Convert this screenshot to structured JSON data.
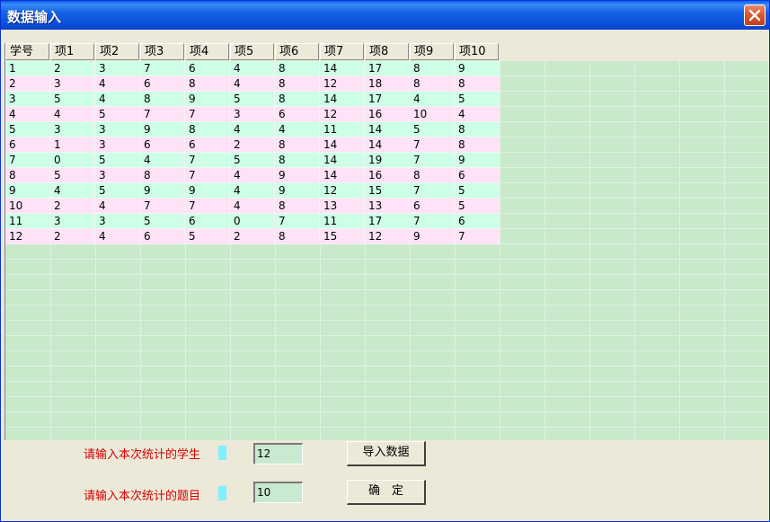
{
  "window": {
    "title": "数据输入",
    "close_icon": "close-icon"
  },
  "table": {
    "columns": [
      "学号",
      "项1",
      "项2",
      "项3",
      "项4",
      "项5",
      "项6",
      "项7",
      "项8",
      "项9",
      "项10"
    ],
    "rows": [
      [
        "1",
        "2",
        "3",
        "7",
        "6",
        "4",
        "8",
        "14",
        "17",
        "8",
        "9"
      ],
      [
        "2",
        "3",
        "4",
        "6",
        "8",
        "4",
        "8",
        "12",
        "18",
        "8",
        "8"
      ],
      [
        "3",
        "5",
        "4",
        "8",
        "9",
        "5",
        "8",
        "14",
        "17",
        "4",
        "5"
      ],
      [
        "4",
        "4",
        "5",
        "7",
        "7",
        "3",
        "6",
        "12",
        "16",
        "10",
        "4"
      ],
      [
        "5",
        "3",
        "3",
        "9",
        "8",
        "4",
        "4",
        "11",
        "14",
        "5",
        "8"
      ],
      [
        "6",
        "1",
        "3",
        "6",
        "6",
        "2",
        "8",
        "14",
        "14",
        "7",
        "8"
      ],
      [
        "7",
        "0",
        "5",
        "4",
        "7",
        "5",
        "8",
        "14",
        "19",
        "7",
        "9"
      ],
      [
        "8",
        "5",
        "3",
        "8",
        "7",
        "4",
        "9",
        "14",
        "16",
        "8",
        "6"
      ],
      [
        "9",
        "4",
        "5",
        "9",
        "9",
        "4",
        "9",
        "12",
        "15",
        "7",
        "5"
      ],
      [
        "10",
        "2",
        "4",
        "7",
        "7",
        "4",
        "8",
        "13",
        "13",
        "6",
        "5"
      ],
      [
        "11",
        "3",
        "3",
        "5",
        "6",
        "0",
        "7",
        "11",
        "17",
        "7",
        "6"
      ],
      [
        "12",
        "2",
        "4",
        "6",
        "5",
        "2",
        "8",
        "15",
        "12",
        "9",
        "7"
      ]
    ],
    "row_colors": {
      "odd": "#ccffe6",
      "even": "#ffe2f7",
      "empty": "#c9e9cb"
    }
  },
  "form": {
    "students_label": "请输入本次统计的学生",
    "students_value": "12",
    "questions_label": "请输入本次统计的题目",
    "questions_value": "10",
    "import_button": "导入数据",
    "ok_button": "确　定"
  },
  "colors": {
    "title_bar": "#0a5fe8",
    "label_red": "#d40000",
    "input_bg": "#c9ead0",
    "cyan_marker": "#7ff0ff"
  }
}
